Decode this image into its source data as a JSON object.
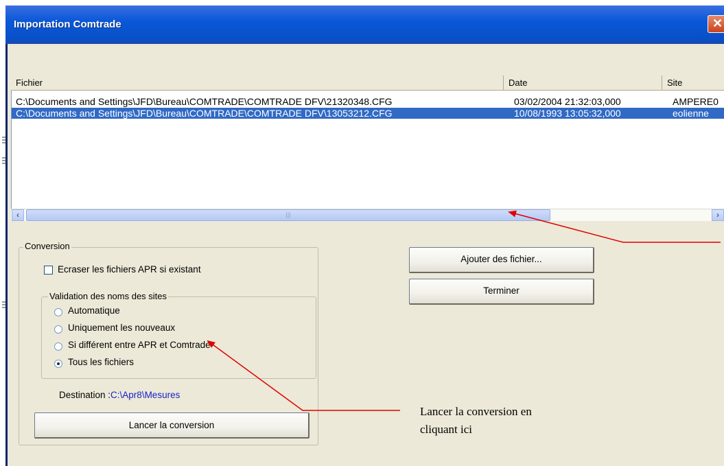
{
  "window": {
    "title": "Importation Comtrade"
  },
  "list": {
    "columns": [
      "Fichier",
      "Date",
      "Site"
    ],
    "rows": [
      {
        "file": "C:\\Documents and Settings\\JFD\\Bureau\\COMTRADE\\COMTRADE DFV\\21320348.CFG",
        "date": "03/02/2004 21:32:03,000",
        "site": "AMPERE0",
        "selected": false
      },
      {
        "file": "C:\\Documents and Settings\\JFD\\Bureau\\COMTRADE\\COMTRADE DFV\\13053212.CFG",
        "date": "10/08/1993 13:05:32,000",
        "site": "eolienne",
        "selected": true
      }
    ]
  },
  "conversion": {
    "group_label": "Conversion",
    "overwrite_label": "Ecraser les fichiers APR si existant",
    "overwrite_checked": false,
    "validation": {
      "group_label": "Validation des noms des sites",
      "options": [
        "Automatique",
        "Uniquement les nouveaux",
        "Si différent entre APR et Comtrade",
        "Tous les fichiers"
      ],
      "selected_index": 3
    },
    "destination_label": "Destination :",
    "destination_value": "C:\\Apr8\\Mesures",
    "start_button": "Lancer la conversion"
  },
  "actions": {
    "add_button": "Ajouter des fichier...",
    "finish_button": "Terminer"
  },
  "annotation": {
    "line1": "Lancer la conversion en",
    "line2": "cliquant ici",
    "arrow_color": "#e00000"
  },
  "icons": {
    "close": "close-icon",
    "scroll_left": "arrow-left-icon",
    "scroll_right": "arrow-right-icon"
  }
}
